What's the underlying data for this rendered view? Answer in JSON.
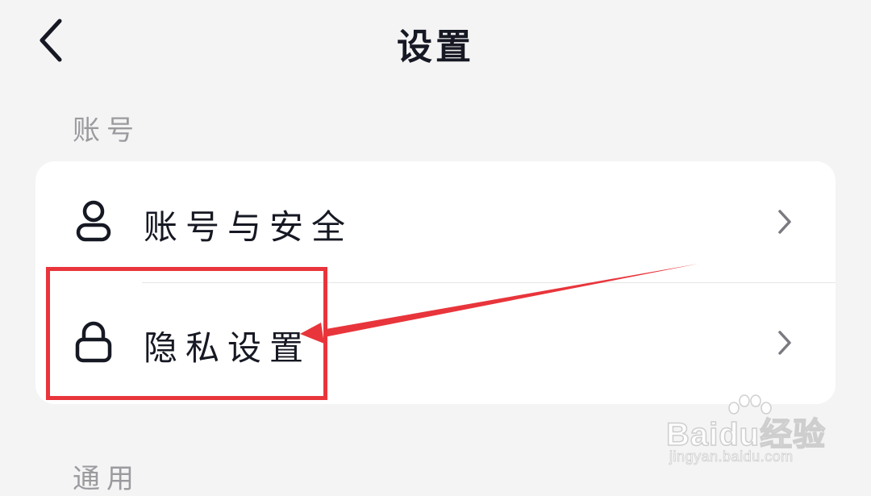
{
  "header": {
    "title": "设置",
    "back_icon": "chevron-left-icon"
  },
  "sections": {
    "account": {
      "label": "账号",
      "items": [
        {
          "label": "账号与安全",
          "icon": "user-icon",
          "trailing_icon": "chevron-right-icon"
        },
        {
          "label": "隐私设置",
          "icon": "lock-icon",
          "trailing_icon": "chevron-right-icon"
        }
      ]
    },
    "general": {
      "label": "通用"
    }
  },
  "annotation": {
    "highlight_color": "#e8353b",
    "target": "隐私设置"
  },
  "watermark": {
    "brand": "Baidu经验",
    "url": "jingyan.baidu.com"
  }
}
